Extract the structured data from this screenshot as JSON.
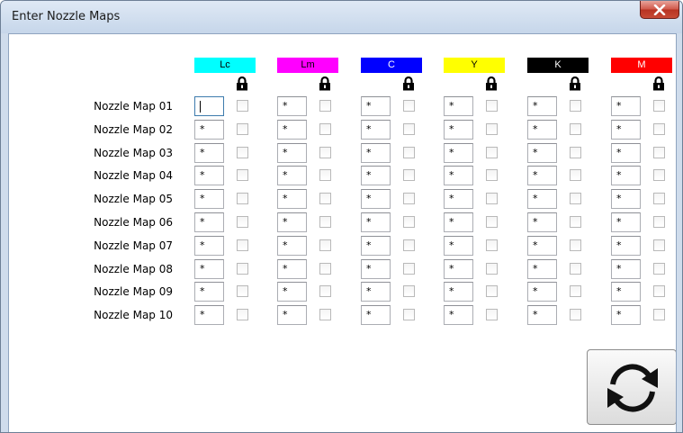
{
  "window": {
    "title": "Enter Nozzle Maps",
    "close_glyph": "X"
  },
  "channels": [
    {
      "label": "Lc",
      "color": "#00ffff",
      "text_color": "#000000"
    },
    {
      "label": "Lm",
      "color": "#ff00ff",
      "text_color": "#000000"
    },
    {
      "label": "C",
      "color": "#0000ff",
      "text_color": "#ffffff"
    },
    {
      "label": "Y",
      "color": "#ffff00",
      "text_color": "#000000"
    },
    {
      "label": "K",
      "color": "#000000",
      "text_color": "#ffffff"
    },
    {
      "label": "M",
      "color": "#ff0000",
      "text_color": "#ffffff"
    }
  ],
  "lock_icon": "padlock-icon",
  "rows": [
    {
      "label": "Nozzle Map 01",
      "values": [
        "",
        "*",
        "*",
        "*",
        "*",
        "*"
      ],
      "locked": [
        false,
        false,
        false,
        false,
        false,
        false
      ]
    },
    {
      "label": "Nozzle Map 02",
      "values": [
        "*",
        "*",
        "*",
        "*",
        "*",
        "*"
      ],
      "locked": [
        false,
        false,
        false,
        false,
        false,
        false
      ]
    },
    {
      "label": "Nozzle Map 03",
      "values": [
        "*",
        "*",
        "*",
        "*",
        "*",
        "*"
      ],
      "locked": [
        false,
        false,
        false,
        false,
        false,
        false
      ]
    },
    {
      "label": "Nozzle Map 04",
      "values": [
        "*",
        "*",
        "*",
        "*",
        "*",
        "*"
      ],
      "locked": [
        false,
        false,
        false,
        false,
        false,
        false
      ]
    },
    {
      "label": "Nozzle Map 05",
      "values": [
        "*",
        "*",
        "*",
        "*",
        "*",
        "*"
      ],
      "locked": [
        false,
        false,
        false,
        false,
        false,
        false
      ]
    },
    {
      "label": "Nozzle Map 06",
      "values": [
        "*",
        "*",
        "*",
        "*",
        "*",
        "*"
      ],
      "locked": [
        false,
        false,
        false,
        false,
        false,
        false
      ]
    },
    {
      "label": "Nozzle Map 07",
      "values": [
        "*",
        "*",
        "*",
        "*",
        "*",
        "*"
      ],
      "locked": [
        false,
        false,
        false,
        false,
        false,
        false
      ]
    },
    {
      "label": "Nozzle Map 08",
      "values": [
        "*",
        "*",
        "*",
        "*",
        "*",
        "*"
      ],
      "locked": [
        false,
        false,
        false,
        false,
        false,
        false
      ]
    },
    {
      "label": "Nozzle Map 09",
      "values": [
        "*",
        "*",
        "*",
        "*",
        "*",
        "*"
      ],
      "locked": [
        false,
        false,
        false,
        false,
        false,
        false
      ]
    },
    {
      "label": "Nozzle Map 10",
      "values": [
        "*",
        "*",
        "*",
        "*",
        "*",
        "*"
      ],
      "locked": [
        false,
        false,
        false,
        false,
        false,
        false
      ]
    }
  ],
  "refresh_button": {
    "icon": "refresh-icon"
  }
}
